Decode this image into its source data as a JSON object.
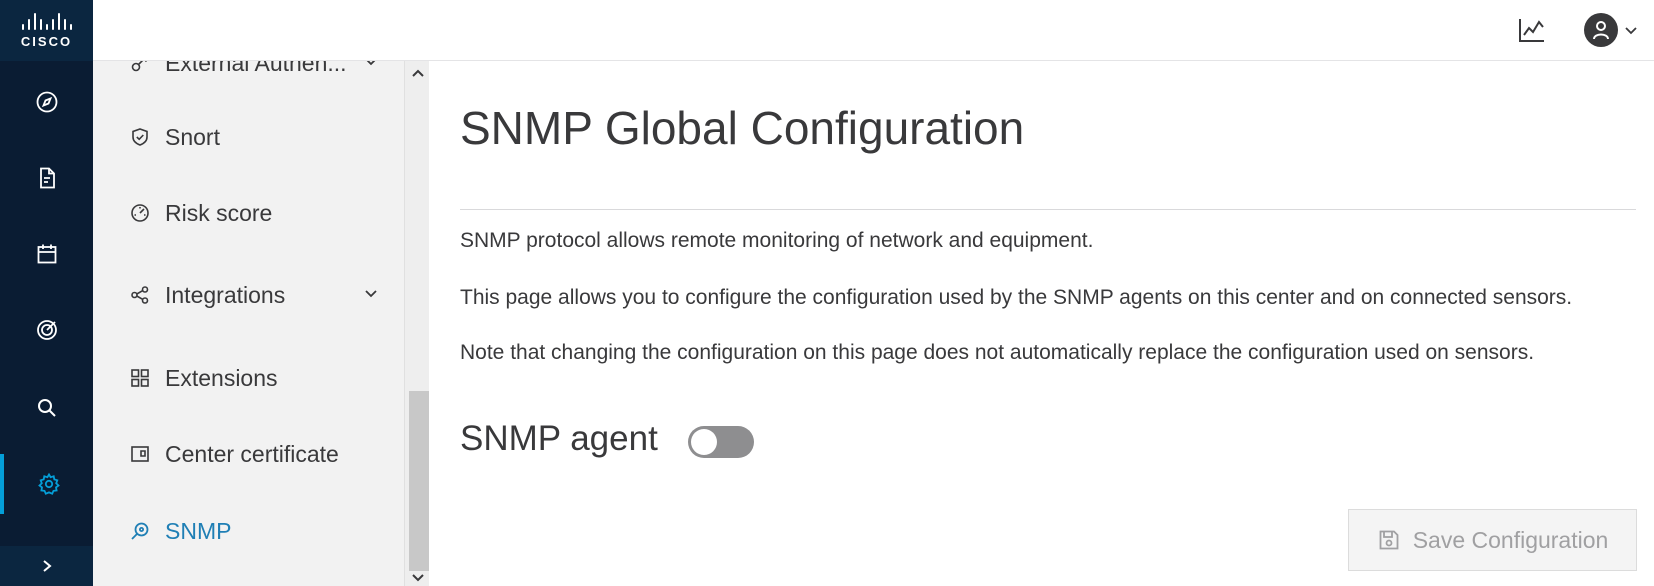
{
  "brand": {
    "logo_text": "CISCO"
  },
  "rail": {
    "items": [
      {
        "icon": "compass-icon",
        "name": "explore"
      },
      {
        "icon": "document-icon",
        "name": "reports"
      },
      {
        "icon": "calendar-icon",
        "name": "events"
      },
      {
        "icon": "target-icon",
        "name": "monitoring"
      },
      {
        "icon": "search-icon",
        "name": "search"
      },
      {
        "icon": "gear-icon",
        "name": "admin",
        "active": true
      }
    ],
    "expand_icon": "chevron-right-icon"
  },
  "topbar": {
    "stats_icon": "line-chart-icon",
    "user_icon": "user-avatar-icon"
  },
  "submenu": {
    "items": [
      {
        "label": "External Authen...",
        "icon": "key-icon",
        "has_chevron": true
      },
      {
        "label": "Snort",
        "icon": "shield-check-icon"
      },
      {
        "label": "Risk score",
        "icon": "gauge-icon"
      },
      {
        "label": "Integrations",
        "icon": "share-nodes-icon",
        "has_chevron": true
      },
      {
        "label": "Extensions",
        "icon": "grid-icon"
      },
      {
        "label": "Center certificate",
        "icon": "certificate-icon"
      },
      {
        "label": "SNMP",
        "icon": "snmp-search-icon",
        "active": true
      }
    ]
  },
  "main": {
    "title": "SNMP Global Configuration",
    "paragraphs": [
      "SNMP protocol allows remote monitoring of network and equipment.",
      "This page allows you to configure the configuration used by the SNMP agents on this center and on connected sensors.",
      "Note that changing the configuration on this page does not automatically replace the configuration used on sensors."
    ],
    "agent_label": "SNMP agent",
    "agent_enabled": false,
    "save_label": "Save Configuration"
  },
  "colors": {
    "rail_bg": "#0a1c33",
    "accent": "#049fd9",
    "active_text": "#1f7fb5"
  }
}
